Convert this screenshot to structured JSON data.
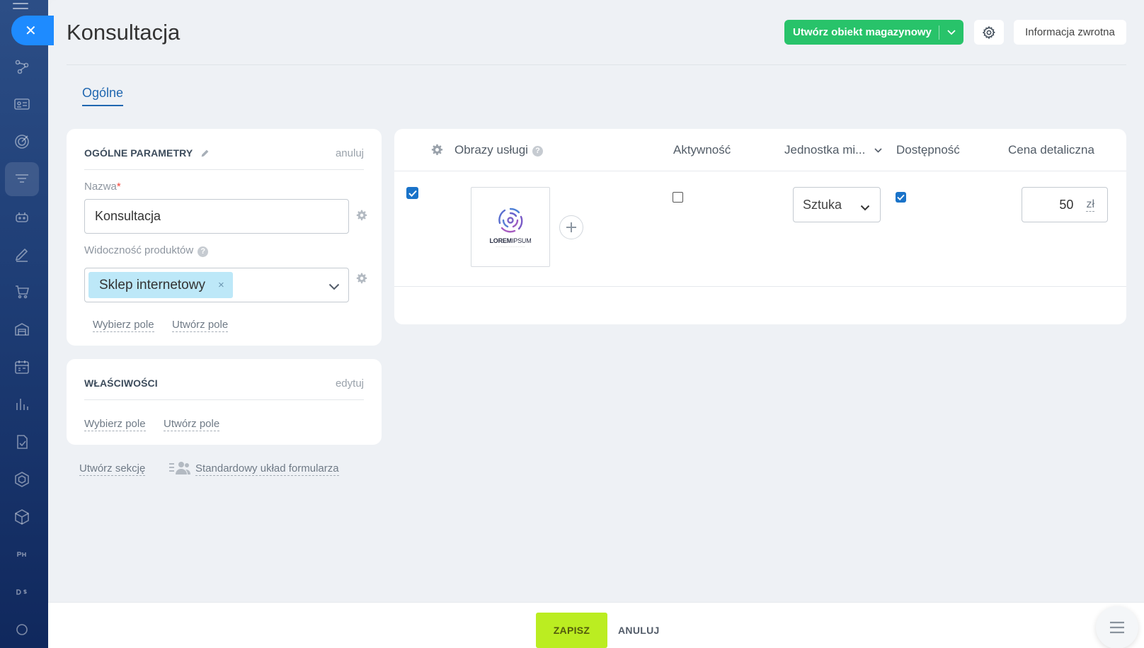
{
  "page": {
    "title": "Konsultacja"
  },
  "header": {
    "create_button_label": "Utwórz obiekt magazynowy",
    "feedback_label": "Informacja zwrotna"
  },
  "tabs": [
    {
      "label": "Ogólne",
      "active": true
    }
  ],
  "general_params": {
    "title": "OGÓLNE PARAMETRY",
    "action": "anuluj",
    "name_label": "Nazwa",
    "name_required_mark": "*",
    "name_value": "Konsultacja",
    "visibility_label": "Widoczność produktów",
    "visibility_help": "?",
    "visibility_tag": "Sklep internetowy",
    "visibility_tag_remove": "×",
    "select_field_link": "Wybierz pole",
    "create_field_link": "Utwórz pole"
  },
  "properties": {
    "title": "WŁAŚCIWOŚCI",
    "action": "edytuj",
    "select_field_link": "Wybierz pole",
    "create_field_link": "Utwórz pole"
  },
  "form_actions": {
    "create_section": "Utwórz sekcję",
    "standard_layout": "Standardowy układ formularza"
  },
  "grid": {
    "columns": {
      "images": "Obrazy usługi",
      "images_help": "?",
      "activity": "Aktywność",
      "unit": "Jednostka mi...",
      "availability": "Dostępność",
      "retail_price": "Cena detaliczna"
    },
    "row": {
      "selected": true,
      "image_logo_text_bold": "LOREM",
      "image_logo_text_light": "IPSUM",
      "activity_checked": false,
      "unit_value": "Sztuka",
      "availability_checked": true,
      "price_value": "50",
      "currency": "zł"
    }
  },
  "footer": {
    "save_label": "ZAPISZ",
    "cancel_label": "ANULUJ"
  },
  "colors": {
    "accent_green": "#28c36a",
    "save_lime": "#bbed21",
    "link_blue": "#2067b0",
    "checkbox_blue": "#1a73c9",
    "rail_dark": "#1e3d75"
  }
}
